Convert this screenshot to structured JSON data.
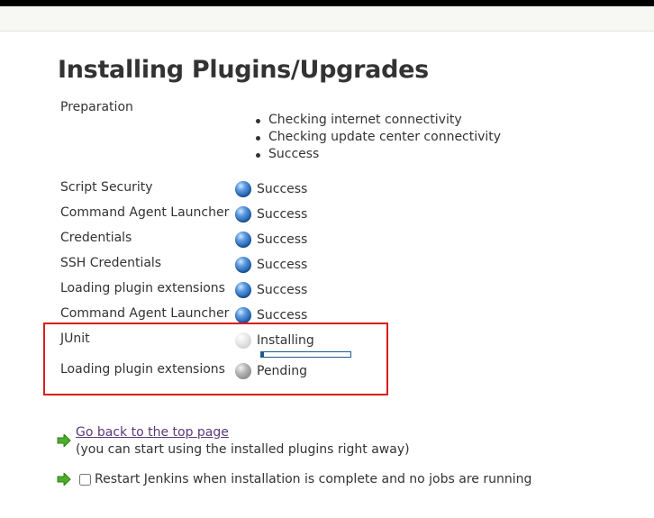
{
  "header": {
    "title": "Installing Plugins/Upgrades"
  },
  "preparation": {
    "label": "Preparation",
    "items": [
      "Checking internet connectivity",
      "Checking update center connectivity",
      "Success"
    ]
  },
  "plugins": [
    {
      "name": "Script Security",
      "status": "Success",
      "ball": "blue"
    },
    {
      "name": "Command Agent Launcher",
      "status": "Success",
      "ball": "blue"
    },
    {
      "name": "Credentials",
      "status": "Success",
      "ball": "blue"
    },
    {
      "name": "SSH Credentials",
      "status": "Success",
      "ball": "blue"
    },
    {
      "name": "Loading plugin extensions",
      "status": "Success",
      "ball": "blue"
    },
    {
      "name": "Command Agent Launcher",
      "status": "Success",
      "ball": "blue"
    },
    {
      "name": "JUnit",
      "status": "Installing",
      "ball": "grey-light",
      "progress": 0.03
    },
    {
      "name": "Loading plugin extensions",
      "status": "Pending",
      "ball": "grey"
    }
  ],
  "footer": {
    "back_link": "Go back to the top page",
    "back_note": "(you can start using the installed plugins right away)",
    "restart_label": "Restart Jenkins when installation is complete and no jobs are running",
    "restart_checked": false
  },
  "colors": {
    "highlight": "#d81e1e",
    "link": "#5b3a7a",
    "arrow": "#4caf2a"
  }
}
